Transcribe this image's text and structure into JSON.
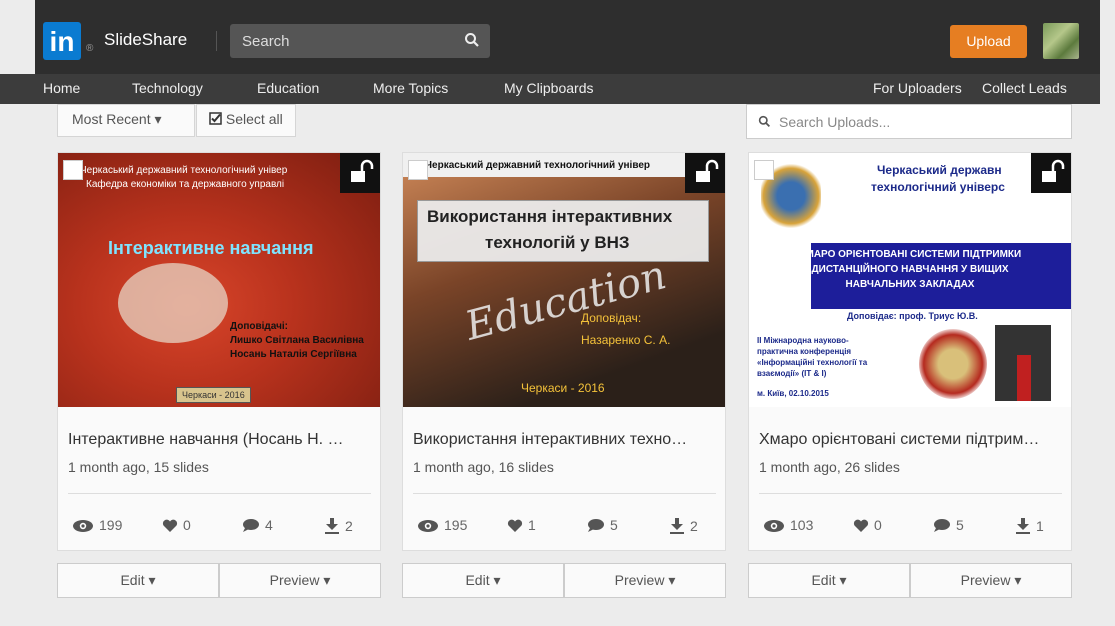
{
  "header": {
    "logo_in": "in",
    "logo_text": "SlideShare",
    "search_placeholder": "Search",
    "upload_label": "Upload"
  },
  "nav": {
    "items": [
      "Home",
      "Technology",
      "Education",
      "More Topics",
      "My Clipboards"
    ],
    "right_items": [
      "For Uploaders",
      "Collect Leads"
    ]
  },
  "toolbar": {
    "sort_label": "Most Recent ▾",
    "select_all_label": "Select all",
    "search_uploads_placeholder": "Search Uploads..."
  },
  "cards": [
    {
      "title": "Інтерактивне навчання (Носань Н. …",
      "meta": "1 month ago, 15 slides",
      "views": "199",
      "likes": "0",
      "comments": "4",
      "downloads": "2",
      "thumb_lines": [
        "Черкаський державний технологічний універ",
        "Кафедра економіки та державного управлі",
        "Інтерактивне навчання",
        "Доповідачі:",
        "Лишко Світлана Василівна",
        "Носань Наталія Сергіївна",
        "Черкаси - 2016"
      ]
    },
    {
      "title": "Використання інтерактивних техно…",
      "meta": "1 month ago, 16 slides",
      "views": "195",
      "likes": "1",
      "comments": "5",
      "downloads": "2",
      "thumb_lines": [
        "Черкаський державний технологічний універ",
        "Використання інтерактивних",
        "технологій у ВНЗ",
        "Доповідач:",
        "Назаренко С. А.",
        "Черкаси - 2016",
        "Education"
      ]
    },
    {
      "title": "Хмаро орієнтовані системи підтрим…",
      "meta": "1 month ago, 26 slides",
      "views": "103",
      "likes": "0",
      "comments": "5",
      "downloads": "1",
      "thumb_lines": [
        "Черкаський державн",
        "технологічний універс",
        "ХМАРО ОРІЄНТОВАНІ СИСТЕМИ ПІДТРИМКИ",
        "ДИСТАНЦІЙНОГО НАВЧАННЯ У ВИЩИХ",
        "НАВЧАЛЬНИХ ЗАКЛАДАХ",
        "Доповідає: проф. Триус Ю.В.",
        "ІІ Міжнародна науково-",
        "практична конференція",
        "«Інформаційні технології та",
        "взаємодії» (IT & I)",
        "м. Київ, 02.10.2015"
      ]
    }
  ],
  "actions": {
    "edit_label": "Edit ▾",
    "preview_label": "Preview ▾"
  },
  "colors": {
    "linkedin_blue": "#0a7bd1",
    "upload_orange": "#e67e22",
    "topbar": "#2e2e2e"
  }
}
